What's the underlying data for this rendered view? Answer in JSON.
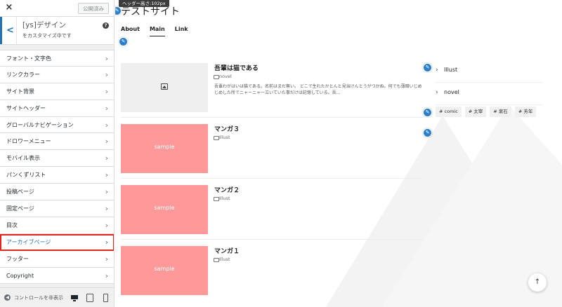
{
  "sidebar": {
    "close_label": "×",
    "publish_label": "公開済み",
    "section_title": "[ys]デザイン",
    "section_subtitle": "をカスタマイズ中です",
    "help_label": "?",
    "back_label": "<",
    "items": [
      {
        "label": "フォント・文字色"
      },
      {
        "label": "リンクカラー"
      },
      {
        "label": "サイト背景"
      },
      {
        "label": "サイトヘッダー"
      },
      {
        "label": "グローバルナビゲーション"
      },
      {
        "label": "ドロワーメニュー"
      },
      {
        "label": "モバイル表示"
      },
      {
        "label": "パンくずリスト"
      },
      {
        "label": "投稿ページ"
      },
      {
        "label": "固定ページ"
      },
      {
        "label": "目次"
      },
      {
        "label": "アーカイブページ",
        "active": true
      },
      {
        "label": "フッター"
      },
      {
        "label": "Copyright"
      }
    ],
    "footer": {
      "hide_controls_label": "コントロールを非表示",
      "devices": [
        "desktop-icon",
        "tablet-icon",
        "mobile-icon"
      ]
    },
    "active_color": "#2271b1",
    "highlight_color": "#e0281c"
  },
  "preview": {
    "header_height_tip": "ヘッダー高さ:102px",
    "site_title": "テストサイト",
    "nav": [
      {
        "label": "About"
      },
      {
        "label": "Main",
        "current": true
      },
      {
        "label": "Link"
      }
    ],
    "posts": [
      {
        "title": "吾輩は猫である",
        "category": "novel",
        "thumb": "placeholder-image",
        "excerpt": "吾輩わがはいは猫である。名前はまだ無い。 どこで生れたかとんと見当けんとうがつかぬ。何でも薄暗いじめじめした所でニャーニャー泣いていた事だけは記憶している。吾…"
      },
      {
        "title": "マンガ３",
        "category": "Illust",
        "thumb": "sample",
        "excerpt": ""
      },
      {
        "title": "マンガ２",
        "category": "Illust",
        "thumb": "sample",
        "excerpt": ""
      },
      {
        "title": "マンガ１",
        "category": "Illust",
        "thumb": "sample",
        "excerpt": ""
      }
    ],
    "sample_label": "sample",
    "widget_categories": [
      {
        "label": "Illust"
      },
      {
        "label": "novel"
      }
    ],
    "widget_tags": [
      "# comic",
      "# 太宰",
      "# 漱石",
      "# 芳年"
    ],
    "to_top_label": "↑",
    "sample_color": "#ff9898",
    "edit_color": "#2d7fcb"
  }
}
